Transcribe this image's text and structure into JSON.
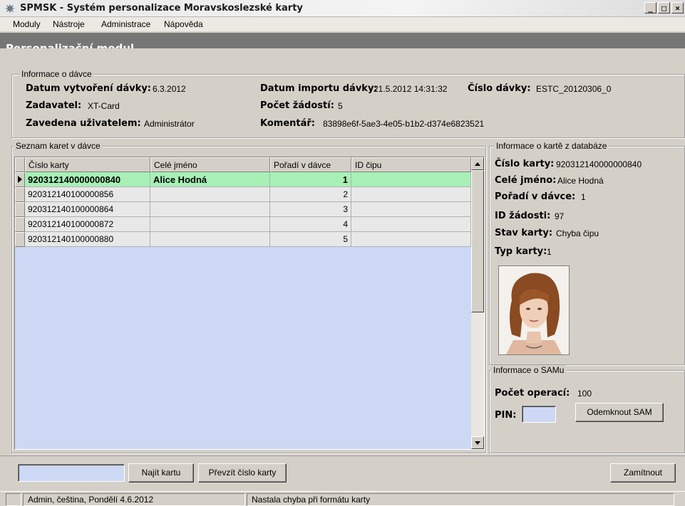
{
  "window": {
    "title": "SPMSK - Systém personalizace Moravskoslezské karty",
    "min_glyph": "_",
    "max_glyph": "□",
    "close_glyph": "×"
  },
  "menu": [
    "Moduly",
    "Nástroje",
    "Administrace",
    "Nápověda"
  ],
  "module_title": "Personalizační modul",
  "batch": {
    "legend": "Informace o dávce",
    "created_label": "Datum vytvoření dávky:",
    "created_value": "6.3.2012",
    "import_label": "Datum importu dávky:",
    "import_value": "21.5.2012 14:31:32",
    "number_label": "Číslo dávky:",
    "number_value": "ESTC_20120306_0",
    "submitter_label": "Zadavatel:",
    "submitter_value": "XT-Card",
    "requests_label": "Počet žádostí:",
    "requests_value": "5",
    "created_by_label": "Zavedena uživatelem:",
    "created_by_value": "Administrátor",
    "comment_label": "Komentář:",
    "comment_value": "83898e6f-5ae3-4e05-b1b2-d374e6823521"
  },
  "cards": {
    "legend": "Seznam karet v dávce",
    "columns": [
      "Číslo karty",
      "Celé jméno",
      "Pořadí v dávce",
      "ID čipu"
    ],
    "rows": [
      {
        "card": "920312140000000840",
        "name": "Alice Hodná",
        "order": "1",
        "chip": ""
      },
      {
        "card": "920312140100000856",
        "name": "",
        "order": "2",
        "chip": ""
      },
      {
        "card": "920312140100000864",
        "name": "",
        "order": "3",
        "chip": ""
      },
      {
        "card": "920312140100000872",
        "name": "",
        "order": "4",
        "chip": ""
      },
      {
        "card": "920312140100000880",
        "name": "",
        "order": "5",
        "chip": ""
      }
    ]
  },
  "card_info": {
    "legend": "Informace o kartě z databáze",
    "number_label": "Číslo karty:",
    "number_value": "920312140000000840",
    "name_label": "Celé jméno:",
    "name_value": "Alice Hodná",
    "order_label": "Pořadí v dávce:",
    "order_value": "1",
    "request_label": "ID žádosti:",
    "request_value": "97",
    "state_label": "Stav karty:",
    "state_value": "Chyba čipu",
    "type_label": "Typ karty:",
    "type_value": "1"
  },
  "sam": {
    "legend": "Informace o SAMu",
    "ops_label": "Počet operací:",
    "ops_value": "100",
    "pin_label": "PIN:",
    "pin_value": "",
    "unlock_button": "Odemknout SAM"
  },
  "bottom": {
    "search_value": "",
    "find_button": "Najít kartu",
    "take_button": "Převzít číslo karty",
    "reject_button": "Zamítnout"
  },
  "status": {
    "user_info": "Admin, čeština, Pondělí 4.6.2012",
    "message": "Nastala chyba při formátu karty"
  },
  "colors": {
    "selected_row": "#a7f0b6",
    "grid_background": "#cdd9f4",
    "module_header": "#767676"
  }
}
